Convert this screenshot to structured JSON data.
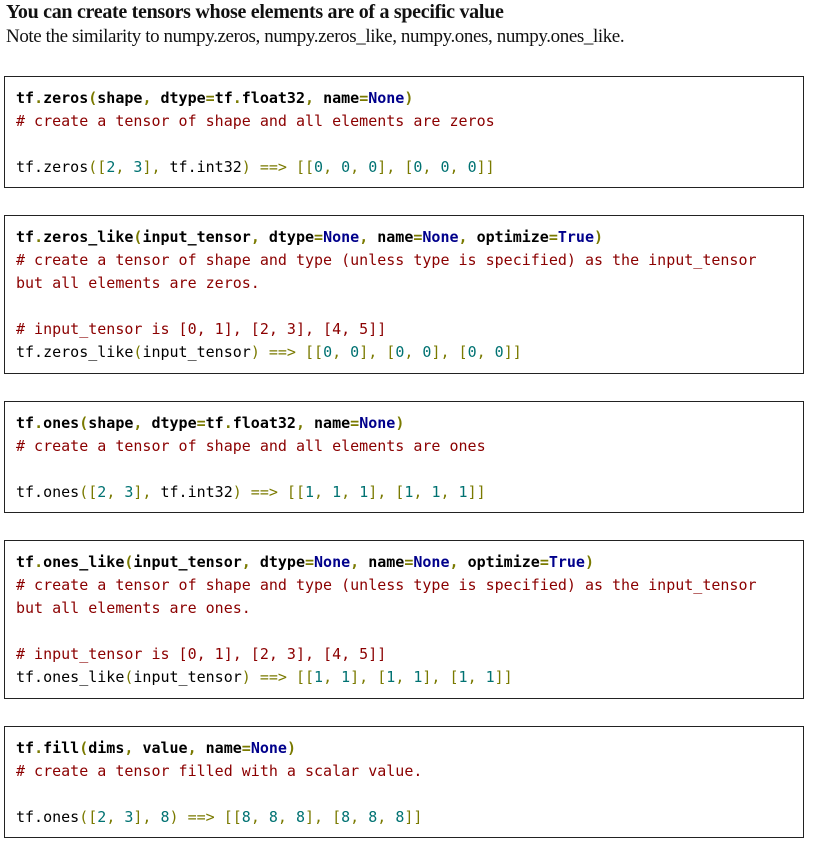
{
  "heading": "You can create tensors whose elements are of  a specific value",
  "subheading": "Note the similarity to numpy.zeros, numpy.zeros_like, numpy.ones,  numpy.ones_like.",
  "blocks": [
    {
      "lines": [
        [
          [
            "tf",
            "b"
          ],
          [
            ".",
            "pb"
          ],
          [
            "zeros",
            "b"
          ],
          [
            "(",
            "pb"
          ],
          [
            "shape",
            "b"
          ],
          [
            ", ",
            "pb"
          ],
          [
            "dtype",
            "b"
          ],
          [
            "=",
            "pb"
          ],
          [
            "tf",
            "b"
          ],
          [
            ".",
            "pb"
          ],
          [
            "float32",
            "b"
          ],
          [
            ", ",
            "pb"
          ],
          [
            "name",
            "b"
          ],
          [
            "=",
            "pb"
          ],
          [
            "None",
            "kb"
          ],
          [
            ")",
            "pb"
          ]
        ],
        [
          [
            "# create a tensor of shape and all elements are zeros",
            "c"
          ]
        ],
        [],
        [
          [
            "tf.zeros",
            "t"
          ],
          [
            "([",
            "p"
          ],
          [
            "2",
            "n"
          ],
          [
            ", ",
            "p"
          ],
          [
            "3",
            "n"
          ],
          [
            "], ",
            "p"
          ],
          [
            "tf.int32",
            "t"
          ],
          [
            ") ==> [[",
            "p"
          ],
          [
            "0",
            "n"
          ],
          [
            ", ",
            "p"
          ],
          [
            "0",
            "n"
          ],
          [
            ", ",
            "p"
          ],
          [
            "0",
            "n"
          ],
          [
            "], [",
            "p"
          ],
          [
            "0",
            "n"
          ],
          [
            ", ",
            "p"
          ],
          [
            "0",
            "n"
          ],
          [
            ", ",
            "p"
          ],
          [
            "0",
            "n"
          ],
          [
            "]]",
            "p"
          ]
        ]
      ]
    },
    {
      "lines": [
        [
          [
            "tf",
            "b"
          ],
          [
            ".",
            "pb"
          ],
          [
            "zeros_like",
            "b"
          ],
          [
            "(",
            "pb"
          ],
          [
            "input_tensor",
            "b"
          ],
          [
            ", ",
            "pb"
          ],
          [
            "dtype",
            "b"
          ],
          [
            "=",
            "pb"
          ],
          [
            "None",
            "kb"
          ],
          [
            ", ",
            "pb"
          ],
          [
            "name",
            "b"
          ],
          [
            "=",
            "pb"
          ],
          [
            "None",
            "kb"
          ],
          [
            ", ",
            "pb"
          ],
          [
            "optimize",
            "b"
          ],
          [
            "=",
            "pb"
          ],
          [
            "True",
            "kb"
          ],
          [
            ")",
            "pb"
          ]
        ],
        [
          [
            "# create a tensor of shape and type (unless type is specified) as the input_tensor",
            "c"
          ]
        ],
        [
          [
            "but all elements are zeros.",
            "c"
          ]
        ],
        [],
        [
          [
            "# input_tensor is [0, 1], [2, 3], [4, 5]]",
            "c"
          ]
        ],
        [
          [
            "tf.zeros_like",
            "t"
          ],
          [
            "(",
            "p"
          ],
          [
            "input_tensor",
            "t"
          ],
          [
            ") ==> [[",
            "p"
          ],
          [
            "0",
            "n"
          ],
          [
            ", ",
            "p"
          ],
          [
            "0",
            "n"
          ],
          [
            "], [",
            "p"
          ],
          [
            "0",
            "n"
          ],
          [
            ", ",
            "p"
          ],
          [
            "0",
            "n"
          ],
          [
            "], [",
            "p"
          ],
          [
            "0",
            "n"
          ],
          [
            ", ",
            "p"
          ],
          [
            "0",
            "n"
          ],
          [
            "]]",
            "p"
          ]
        ]
      ]
    },
    {
      "lines": [
        [
          [
            "tf",
            "b"
          ],
          [
            ".",
            "pb"
          ],
          [
            "ones",
            "b"
          ],
          [
            "(",
            "pb"
          ],
          [
            "shape",
            "b"
          ],
          [
            ", ",
            "pb"
          ],
          [
            "dtype",
            "b"
          ],
          [
            "=",
            "pb"
          ],
          [
            "tf",
            "b"
          ],
          [
            ".",
            "pb"
          ],
          [
            "float32",
            "b"
          ],
          [
            ", ",
            "pb"
          ],
          [
            "name",
            "b"
          ],
          [
            "=",
            "pb"
          ],
          [
            "None",
            "kb"
          ],
          [
            ")",
            "pb"
          ]
        ],
        [
          [
            "# create a tensor of shape and all elements are ones",
            "c"
          ]
        ],
        [],
        [
          [
            "tf.ones",
            "t"
          ],
          [
            "([",
            "p"
          ],
          [
            "2",
            "n"
          ],
          [
            ", ",
            "p"
          ],
          [
            "3",
            "n"
          ],
          [
            "], ",
            "p"
          ],
          [
            "tf.int32",
            "t"
          ],
          [
            ") ==> [[",
            "p"
          ],
          [
            "1",
            "n"
          ],
          [
            ", ",
            "p"
          ],
          [
            "1",
            "n"
          ],
          [
            ", ",
            "p"
          ],
          [
            "1",
            "n"
          ],
          [
            "], [",
            "p"
          ],
          [
            "1",
            "n"
          ],
          [
            ", ",
            "p"
          ],
          [
            "1",
            "n"
          ],
          [
            ", ",
            "p"
          ],
          [
            "1",
            "n"
          ],
          [
            "]]",
            "p"
          ]
        ]
      ]
    },
    {
      "lines": [
        [
          [
            "tf",
            "b"
          ],
          [
            ".",
            "pb"
          ],
          [
            "ones_like",
            "b"
          ],
          [
            "(",
            "pb"
          ],
          [
            "input_tensor",
            "b"
          ],
          [
            ", ",
            "pb"
          ],
          [
            "dtype",
            "b"
          ],
          [
            "=",
            "pb"
          ],
          [
            "None",
            "kb"
          ],
          [
            ", ",
            "pb"
          ],
          [
            "name",
            "b"
          ],
          [
            "=",
            "pb"
          ],
          [
            "None",
            "kb"
          ],
          [
            ", ",
            "pb"
          ],
          [
            "optimize",
            "b"
          ],
          [
            "=",
            "pb"
          ],
          [
            "True",
            "kb"
          ],
          [
            ")",
            "pb"
          ]
        ],
        [
          [
            "# create a tensor of shape and type (unless type is specified) as the input_tensor",
            "c"
          ]
        ],
        [
          [
            "but all elements are ones.",
            "c"
          ]
        ],
        [],
        [
          [
            "# input_tensor is [0, 1], [2, 3], [4, 5]]",
            "c"
          ]
        ],
        [
          [
            "tf.ones_like",
            "t"
          ],
          [
            "(",
            "p"
          ],
          [
            "input_tensor",
            "t"
          ],
          [
            ") ==> [[",
            "p"
          ],
          [
            "1",
            "n"
          ],
          [
            ", ",
            "p"
          ],
          [
            "1",
            "n"
          ],
          [
            "], [",
            "p"
          ],
          [
            "1",
            "n"
          ],
          [
            ", ",
            "p"
          ],
          [
            "1",
            "n"
          ],
          [
            "], [",
            "p"
          ],
          [
            "1",
            "n"
          ],
          [
            ", ",
            "p"
          ],
          [
            "1",
            "n"
          ],
          [
            "]]",
            "p"
          ]
        ]
      ]
    },
    {
      "lines": [
        [
          [
            "tf",
            "b"
          ],
          [
            ".",
            "pb"
          ],
          [
            "fill",
            "b"
          ],
          [
            "(",
            "pb"
          ],
          [
            "dims",
            "b"
          ],
          [
            ", ",
            "pb"
          ],
          [
            "value",
            "b"
          ],
          [
            ", ",
            "pb"
          ],
          [
            "name",
            "b"
          ],
          [
            "=",
            "pb"
          ],
          [
            "None",
            "kb"
          ],
          [
            ")",
            "pb"
          ]
        ],
        [
          [
            "# create a tensor filled with a scalar value.",
            "c"
          ]
        ],
        [],
        [
          [
            "tf.ones",
            "t"
          ],
          [
            "([",
            "p"
          ],
          [
            "2",
            "n"
          ],
          [
            ", ",
            "p"
          ],
          [
            "3",
            "n"
          ],
          [
            "], ",
            "p"
          ],
          [
            "8",
            "n"
          ],
          [
            ") ==> [[",
            "p"
          ],
          [
            "8",
            "n"
          ],
          [
            ", ",
            "p"
          ],
          [
            "8",
            "n"
          ],
          [
            ", ",
            "p"
          ],
          [
            "8",
            "n"
          ],
          [
            "], [",
            "p"
          ],
          [
            "8",
            "n"
          ],
          [
            ", ",
            "p"
          ],
          [
            "8",
            "n"
          ],
          [
            ", ",
            "p"
          ],
          [
            "8",
            "n"
          ],
          [
            "]]",
            "p"
          ]
        ]
      ]
    }
  ]
}
